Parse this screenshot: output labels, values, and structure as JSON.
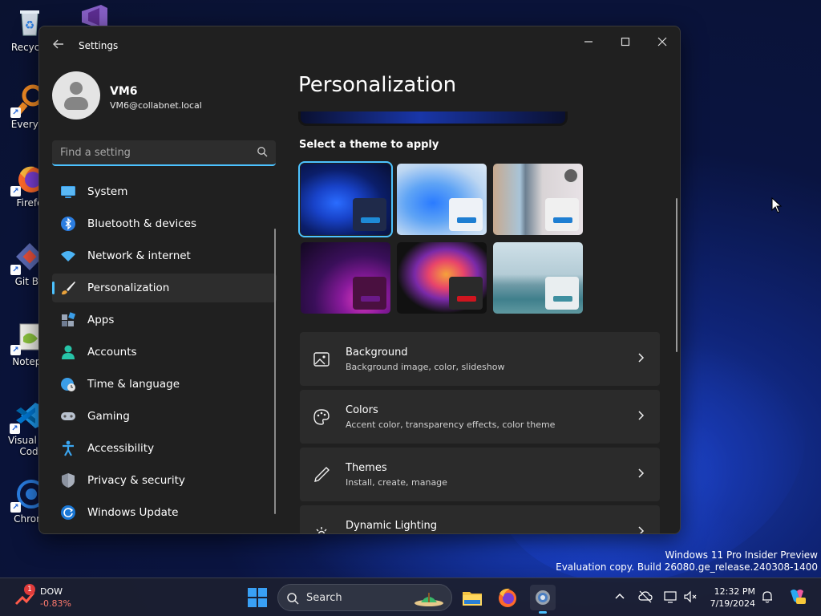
{
  "desktop": {
    "icons": [
      {
        "label": "Recycle"
      },
      {
        "label": "Everyth"
      },
      {
        "label": "Firefo"
      },
      {
        "label": "Git Ba"
      },
      {
        "label": "Notepa"
      },
      {
        "label": "Visual St"
      },
      {
        "label": "Cod"
      },
      {
        "label": "Chrom"
      }
    ]
  },
  "window": {
    "title": "Settings",
    "controls": {
      "minimize": "—",
      "maximize": "☐",
      "close": "✕"
    }
  },
  "profile": {
    "name": "VM6",
    "email": "VM6@collabnet.local"
  },
  "search": {
    "placeholder": "Find a setting"
  },
  "nav": {
    "items": [
      {
        "label": "System",
        "icon": "monitor-icon"
      },
      {
        "label": "Bluetooth & devices",
        "icon": "bluetooth-icon"
      },
      {
        "label": "Network & internet",
        "icon": "wifi-icon"
      },
      {
        "label": "Personalization",
        "icon": "brush-icon",
        "selected": true
      },
      {
        "label": "Apps",
        "icon": "apps-icon"
      },
      {
        "label": "Accounts",
        "icon": "person-icon"
      },
      {
        "label": "Time & language",
        "icon": "globe-clock-icon"
      },
      {
        "label": "Gaming",
        "icon": "gamepad-icon"
      },
      {
        "label": "Accessibility",
        "icon": "accessibility-icon"
      },
      {
        "label": "Privacy & security",
        "icon": "shield-icon"
      },
      {
        "label": "Windows Update",
        "icon": "update-icon"
      }
    ]
  },
  "main": {
    "title": "Personalization",
    "themes_heading": "Select a theme to apply",
    "themes": [
      {
        "name": "windows-dark",
        "selected": true
      },
      {
        "name": "windows-light"
      },
      {
        "name": "spotlight-slideshow"
      },
      {
        "name": "glow"
      },
      {
        "name": "captured-motion"
      },
      {
        "name": "flow"
      }
    ],
    "cards": [
      {
        "title": "Background",
        "subtitle": "Background image, color, slideshow",
        "icon": "image-icon"
      },
      {
        "title": "Colors",
        "subtitle": "Accent color, transparency effects, color theme",
        "icon": "palette-icon"
      },
      {
        "title": "Themes",
        "subtitle": "Install, create, manage",
        "icon": "pen-icon"
      },
      {
        "title": "Dynamic Lighting",
        "subtitle": "",
        "icon": "lighting-icon"
      }
    ]
  },
  "watermark": {
    "line1": "Windows 11 Pro Insider Preview",
    "line2": "Evaluation copy. Build 26080.ge_release.240308-1400"
  },
  "taskbar": {
    "widget": {
      "badge": "1",
      "title": "DOW",
      "value": "-0.83%"
    },
    "search_label": "Search",
    "clock": {
      "time": "12:32 PM",
      "date": "7/19/2024"
    }
  },
  "colors": {
    "accent": "#4cc2ff",
    "window_bg": "#202020",
    "card_bg": "#2b2b2b",
    "negative": "#ff7a6e"
  }
}
